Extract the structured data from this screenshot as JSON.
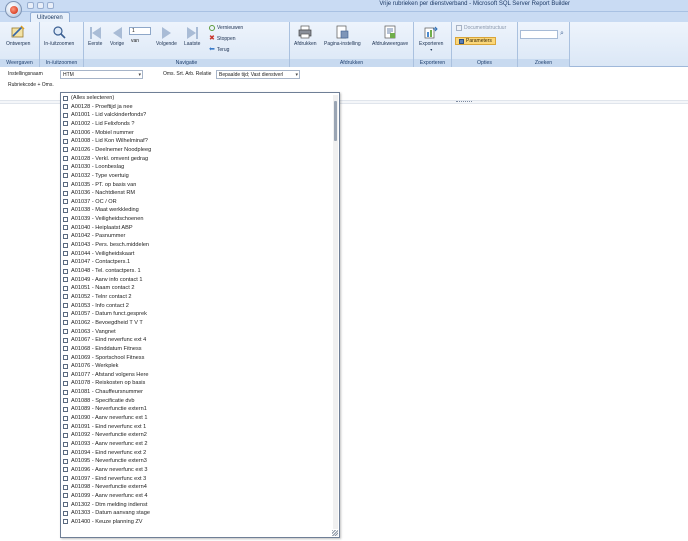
{
  "window": {
    "title": "Vrije rubrieken per dienstverband - Microsoft SQL Server Report Builder"
  },
  "tabs": [
    {
      "label": "Uitvoeren"
    }
  ],
  "ribbon": {
    "groups": {
      "weergaven": "Weergaven",
      "in_uitzoomen": "In-/uitzoomen",
      "navigatie": "Navigatie",
      "afdrukken": "Afdrukken",
      "exporteren": "Exporteren",
      "opties": "Opties",
      "zoeken": "Zoeken"
    },
    "buttons": {
      "ontwerpen": "Ontwerpen",
      "in_uitzoomen": "In-/uitzoomen",
      "eerste": "Eerste",
      "vorige": "Vorige",
      "volgende": "Volgende",
      "laatste": "Laatste",
      "vernieuwen": "Vernieuwen",
      "stoppen": "Stoppen",
      "terug": "Terug",
      "afdrukken": "Afdrukken",
      "pagina_instelling": "Pagina-instelling",
      "afdrukweergave": "Afdrukweergave",
      "exporteren": "Exporteren",
      "documentstructuur": "Documentstructuur",
      "parameters": "Parameters"
    },
    "page_number": "1",
    "page_of_label": "van"
  },
  "params": {
    "instellingsnaam_label": "Instellingsnaam",
    "instellingsnaam_value": "HTM",
    "oms_label": "Oms. Srt. Arb. Relatie",
    "oms_value": "Bepaalde tijd; Vast dienstverl",
    "rubriekcode_label": "Rubriekcode + Oms."
  },
  "dropdown_items": [
    "(Alles selecteren)",
    "A00128 - Proeftijd ja nee",
    "A01001 - Lid valckinderfonds?",
    "A01002 - Lid Felixfonds      ?",
    "A01006 - Mobiel nummer",
    "A01008 - Lid Kon Wilhelminaf?",
    "A01026 - Deelnemer Noodpleeg",
    "A01028 - Verkl. omvent gedrag",
    "A01030 - Loonbeslag",
    "A01032 - Type voertuig",
    "A01035 - PT. op basis van",
    "A01036 - Nachtdienst RM",
    "A01037 - OC / OR",
    "A01038 - Maat werkkleding",
    "A01039 - Veiligheidschoenen",
    "A01040 - Heiplaatst ABP",
    "A01042 - Pasnummer",
    "A01043 - Pers. besch.middelen",
    "A01044 - Veiligheidskaart",
    "A01047 - Contactpers.1",
    "A01048 - Tel. contactpers. 1",
    "A01049 - Aanv info contact 1",
    "A01051 - Naam contact 2",
    "A01052 - Telnr contact 2",
    "A01053 - Info contact 2",
    "A01057 - Datum funct.gesprek",
    "A01062 - Bevoegdheid T V T",
    "A01063 - Vangnet",
    "A01067 - Eind neverfunc ext 4",
    "A01068 - Einddatum Fitness",
    "A01069 - Sportschool Fitness",
    "A01076 - Werkplek",
    "A01077 - Afstand volgens Here",
    "A01078 - Reiskosten op basis",
    "A01081 - Chauffeursnummer",
    "A01088 - Specificatie dvb",
    "A01089 - Neverfunctie extern1",
    "A01090 - Aanv neverfunc ext 1",
    "A01091 - Eind neverfunc ext 1",
    "A01092 - Neverfunctie extern2",
    "A01093 - Aanv neverfunc ext 2",
    "A01094 - Eind neverfunc ext 2",
    "A01095 - Neverfunctie extern3",
    "A01096 - Aanv neverfunc ext 3",
    "A01097 - Eind neverfunc ext 3",
    "A01098 - Neverfunctie extern4",
    "A01099 - Aanv neverfunc ext 4",
    "A01302 - Dtm melding indienst",
    "A01303 - Datum aanvang stage",
    "A01400 - Keuze planning ZV"
  ]
}
